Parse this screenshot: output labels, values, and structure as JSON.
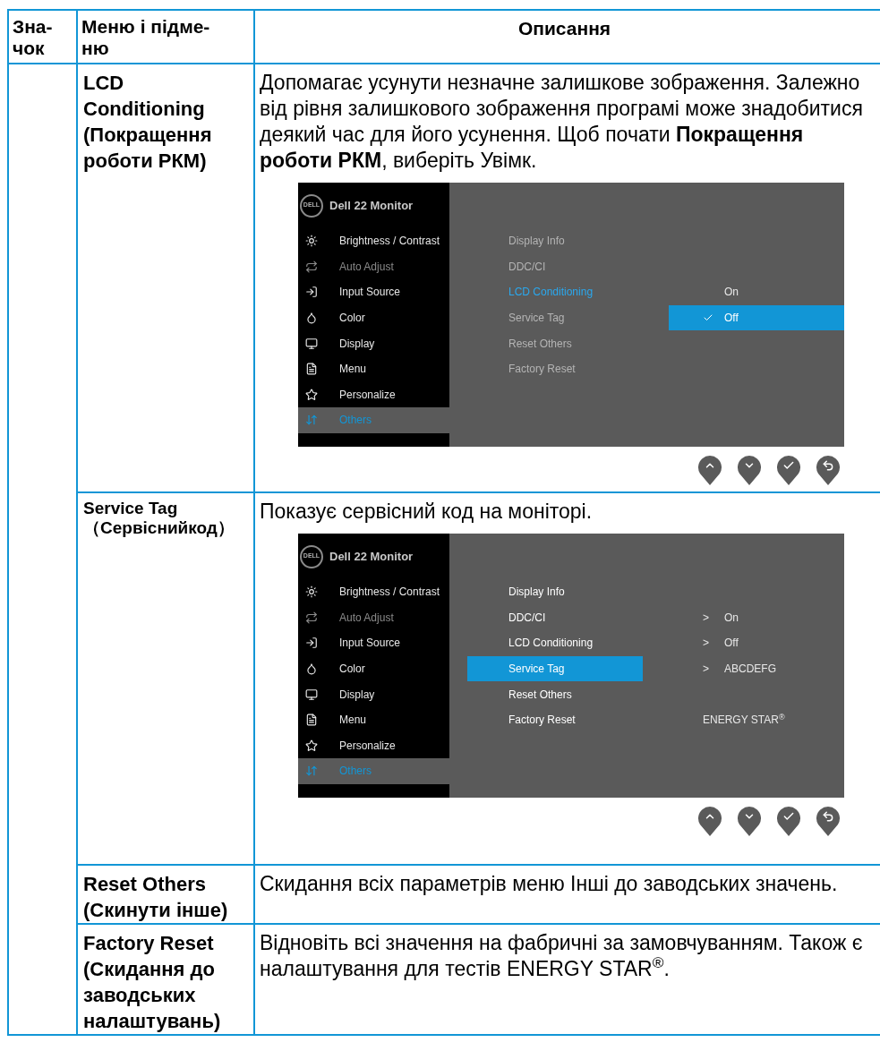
{
  "columns": [
    {
      "lines": [
        "Зна-",
        "чок"
      ]
    },
    {
      "lines": [
        "Меню і підме-",
        "ню"
      ]
    },
    {
      "lines": [
        "Описання"
      ]
    }
  ],
  "rows": [
    {
      "menu": [
        "LCD",
        "Conditioning",
        "(Покращення",
        "роботи РКМ)"
      ],
      "description": "Допомагає усунути незначне залишкове зображення. Залежно від рівня залишкового зображення програмі може знадобитися деякий час для його усунення. Щоб почати **Покращення роботи РКМ**, виберіть Увімк.",
      "osd": {
        "logo": "DELL",
        "title": "Dell 22 Monitor",
        "menu": [
          {
            "kind": "brightness",
            "label": "Brightness / Contrast",
            "disabled": false,
            "selected": false
          },
          {
            "kind": "auto",
            "label": "Auto Adjust",
            "disabled": true,
            "selected": false
          },
          {
            "kind": "input",
            "label": "Input Source",
            "disabled": false,
            "selected": false
          },
          {
            "kind": "color",
            "label": "Color",
            "disabled": false,
            "selected": false
          },
          {
            "kind": "display",
            "label": "Display",
            "disabled": false,
            "selected": false
          },
          {
            "kind": "menu",
            "label": "Menu",
            "disabled": false,
            "selected": false
          },
          {
            "kind": "personalize",
            "label": "Personalize",
            "disabled": false,
            "selected": false
          },
          {
            "kind": "others",
            "label": "Others",
            "disabled": false,
            "selected": true
          }
        ],
        "submenu": [
          {
            "label": "Display Info",
            "dimmed": true,
            "current": false,
            "selected": false
          },
          {
            "label": "DDC/CI",
            "dimmed": true,
            "current": false,
            "selected": false
          },
          {
            "label": "LCD Conditioning",
            "dimmed": false,
            "current": true,
            "selected": false,
            "value": {
              "text": "On",
              "checked": false,
              "selected": false
            }
          },
          {
            "label": "Service Tag",
            "dimmed": true,
            "current": false,
            "selected": false,
            "value": {
              "text": "Off",
              "checked": true,
              "selected": true
            }
          },
          {
            "label": "Reset Others",
            "dimmed": true,
            "current": false,
            "selected": false
          },
          {
            "label": "Factory Reset",
            "dimmed": true,
            "current": false,
            "selected": false
          }
        ],
        "buttons": [
          {
            "kind": "up"
          },
          {
            "kind": "down"
          },
          {
            "kind": "ok"
          },
          {
            "kind": "back"
          }
        ]
      }
    },
    {
      "menu": [
        "Service Tag",
        "（Сервіснийкод）"
      ],
      "description": "Показує сервісний код на моніторі.",
      "osd": {
        "logo": "DELL",
        "title": "Dell 22 Monitor",
        "menu": [
          {
            "kind": "brightness",
            "label": "Brightness / Contrast",
            "disabled": false,
            "selected": false
          },
          {
            "kind": "auto",
            "label": "Auto Adjust",
            "disabled": true,
            "selected": false
          },
          {
            "kind": "input",
            "label": "Input Source",
            "disabled": false,
            "selected": false
          },
          {
            "kind": "color",
            "label": "Color",
            "disabled": false,
            "selected": false
          },
          {
            "kind": "display",
            "label": "Display",
            "disabled": false,
            "selected": false
          },
          {
            "kind": "menu",
            "label": "Menu",
            "disabled": false,
            "selected": false
          },
          {
            "kind": "personalize",
            "label": "Personalize",
            "disabled": false,
            "selected": false
          },
          {
            "kind": "others",
            "label": "Others",
            "disabled": false,
            "selected": true
          }
        ],
        "submenu": [
          {
            "label": "Display Info",
            "dimmed": false,
            "current": false,
            "selected": false
          },
          {
            "label": "DDC/CI",
            "dimmed": false,
            "current": false,
            "selected": false,
            "value": {
              "marker": ">",
              "text": "On"
            }
          },
          {
            "label": "LCD Conditioning",
            "dimmed": false,
            "current": false,
            "selected": false,
            "value": {
              "marker": ">",
              "text": "Off"
            }
          },
          {
            "label": "Service Tag",
            "dimmed": false,
            "current": false,
            "selected": true,
            "value": {
              "marker": ">",
              "text": "ABCDEFG"
            }
          },
          {
            "label": "Reset Others",
            "dimmed": false,
            "current": false,
            "selected": false
          },
          {
            "label": "Factory Reset",
            "dimmed": false,
            "current": false,
            "selected": false,
            "value": {
              "text": "ENERGY STAR$^{®}$"
            }
          }
        ],
        "buttons": [
          {
            "kind": "up"
          },
          {
            "kind": "down"
          },
          {
            "kind": "ok"
          },
          {
            "kind": "back"
          }
        ]
      }
    },
    {
      "menu": [
        "Reset Others",
        "(Скинути інше)"
      ],
      "description": "Скидання всіх параметрів меню Інші до заводських значень."
    },
    {
      "menu": [
        "Factory Reset",
        "(Скидання до",
        "заводських",
        "налаштувань)"
      ],
      "description": "Відновіть всі значення на фабричні за замовчуванням. Також є налаштування для тестів ENERGY STAR$^{®}$."
    }
  ]
}
